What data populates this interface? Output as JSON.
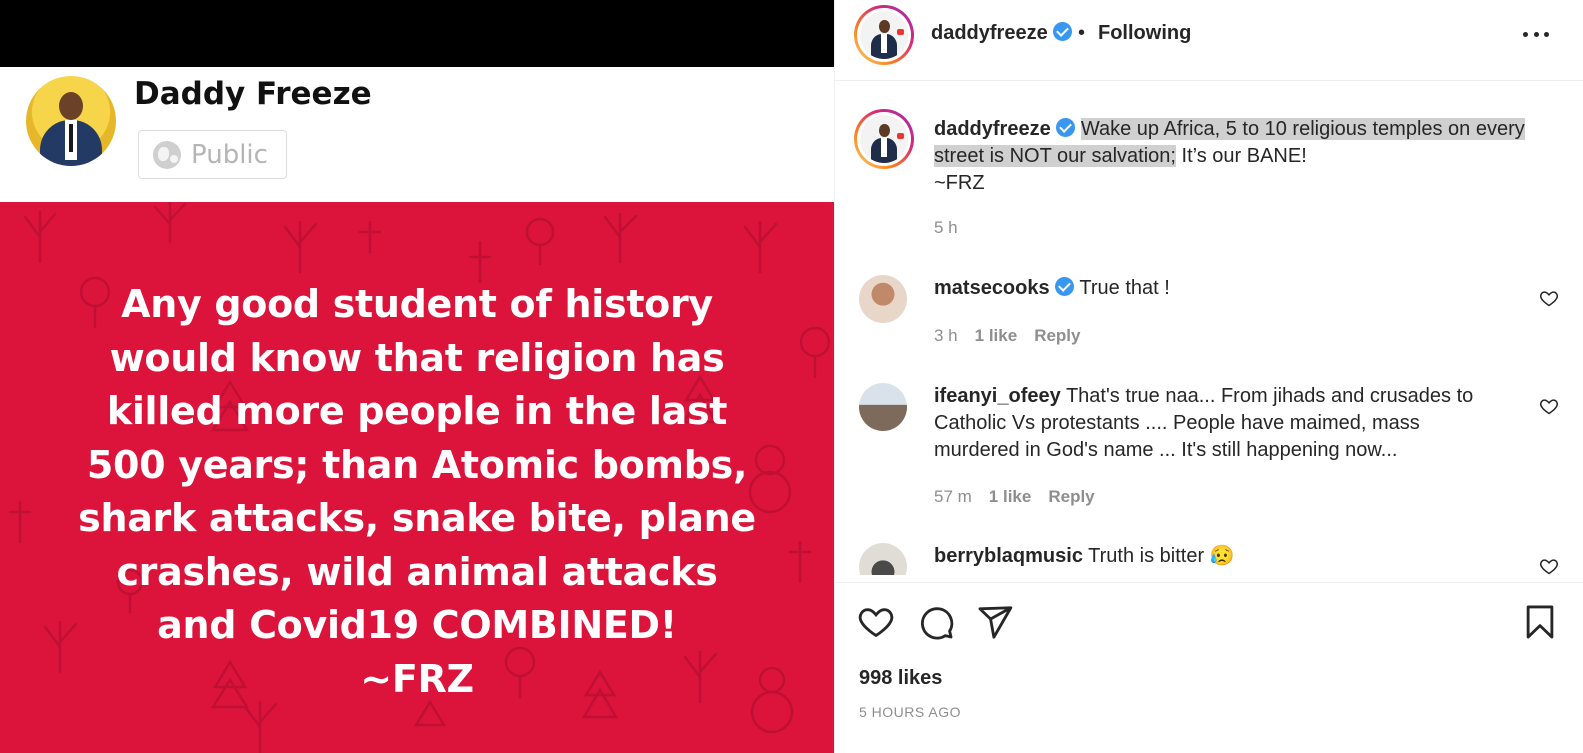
{
  "post_image": {
    "name": "Daddy Freeze",
    "audience": "Public",
    "quote_lines": [
      "Any good student of history",
      "would know that religion has",
      "killed more people in the last",
      "500 years; than Atomic bombs,",
      "shark attacks, snake bite, plane",
      "crashes, wild animal attacks",
      "and Covid19 COMBINED!",
      "~FRZ"
    ],
    "card_color": "#dc143c"
  },
  "header": {
    "username": "daddyfreeze",
    "separator": "•",
    "follow_status": "Following"
  },
  "caption": {
    "username": "daddyfreeze",
    "text_highlighted": "Wake up Africa, 5 to 10 religious temples on every street is NOT our salvation;",
    "text_rest": " It’s our BANE!",
    "signature": "~FRZ",
    "time": "5 h"
  },
  "comments": [
    {
      "username": "matsecooks",
      "verified": true,
      "text": "True that !",
      "time": "3 h",
      "likes": "1 like",
      "reply": "Reply"
    },
    {
      "username": "ifeanyi_ofeey",
      "verified": false,
      "text": "That's true naa... From jihads and crusades to Catholic Vs protestants .... People have maimed, mass murdered in God's name ... It's still happening now...",
      "time": "57 m",
      "likes": "1 like",
      "reply": "Reply"
    },
    {
      "username": "berryblaqmusic",
      "verified": false,
      "text": "Truth is bitter 😥"
    }
  ],
  "footer": {
    "likes": "998 likes",
    "posted": "5 HOURS AGO"
  },
  "colors": {
    "verified": "#3897f0",
    "muted_text": "#8e8e8e",
    "primary_text": "#262626"
  }
}
